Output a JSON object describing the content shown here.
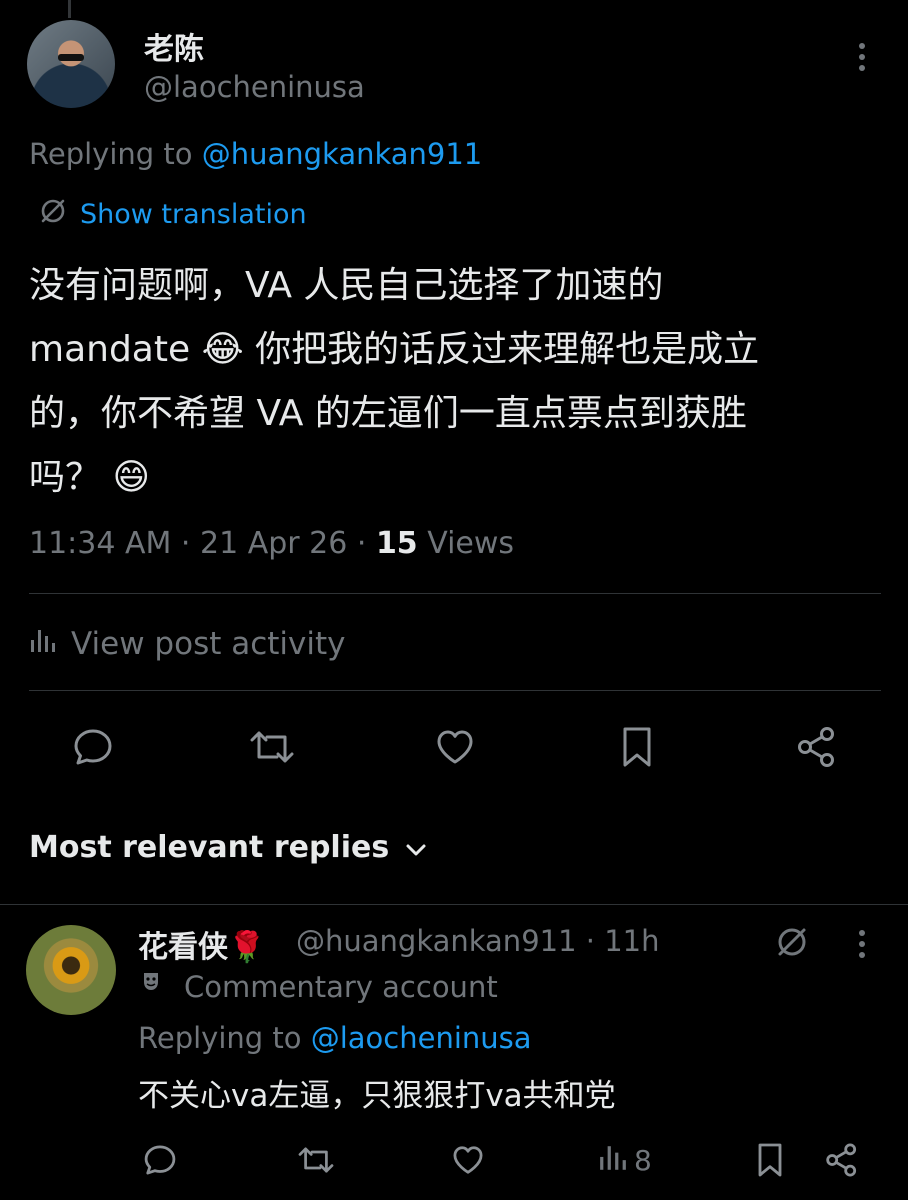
{
  "post": {
    "display_name": "老陈",
    "handle": "@laocheninusa",
    "replying_prefix": "Replying to",
    "replying_to": "@huangkankan911",
    "show_translation": "Show translation",
    "text_line1": "没有问题啊，VA 人民自己选择了加速的",
    "text_line2": "mandate 😂 你把我的话反过来理解也是成立",
    "text_line3": "的，你不希望 VA 的左逼们一直点票点到获胜",
    "text_line4": "吗？ 😄",
    "time": "11:34 AM · 21 Apr 26 · ",
    "views_count": "15",
    "views_label": " Views",
    "view_activity": "View post activity",
    "replies_sort": "Most relevant replies"
  },
  "reply": {
    "display_name": "花看侠🌹",
    "handle_time": "@huangkankan911 · 11h",
    "label": "Commentary account",
    "replying_prefix": "Replying to",
    "replying_to": "@laocheninusa",
    "text": "不关心va左逼，只狠狠打va共和党",
    "views": "8"
  },
  "colors": {
    "background": "#000000",
    "text": "#e7e9ea",
    "muted": "#71767b",
    "link": "#1d9bf0",
    "divider": "#2f3336"
  }
}
